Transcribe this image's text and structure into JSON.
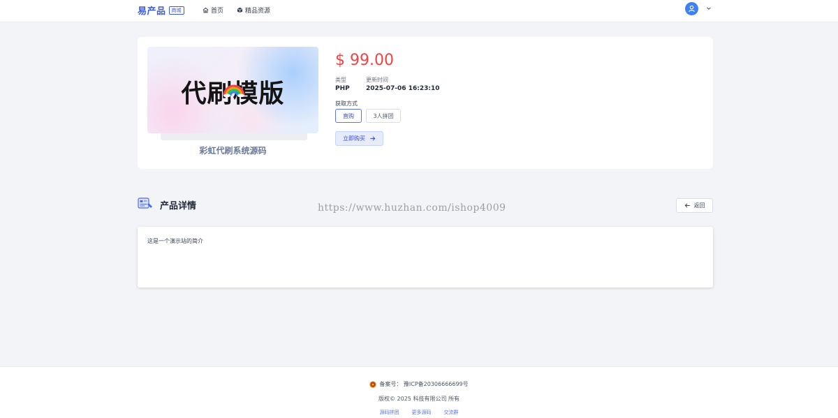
{
  "header": {
    "brand": "易产品",
    "brand_tag": "商城",
    "nav": [
      {
        "label": "首页",
        "icon": "home-icon"
      },
      {
        "label": "精品资源",
        "icon": "cube-icon"
      }
    ],
    "avatar_icon": "user-icon",
    "accent_color": "#3b5bdb"
  },
  "product": {
    "cover_text": "代刷模版",
    "title": "彩虹代刷系统源码",
    "price": "$ 99.00",
    "type_label": "类型",
    "type_value": "PHP",
    "updated_label": "更新时间",
    "updated_value": "2025-07-06 16:23:10",
    "get_label": "获取方式",
    "options": [
      "直购",
      "3人拼团"
    ],
    "selected_option": "直购",
    "buy_label": "立即购买",
    "price_color": "#ef4444"
  },
  "detail": {
    "title": "产品详情",
    "watermark": "https://www.huzhan.com/ishop4009",
    "back_label": "返回",
    "description": "这是一个演示站的简介"
  },
  "footer": {
    "icp": "备案号： 豫ICP备20306666699号",
    "copyright": "版权© 2025 科技有限公司 所有",
    "links": [
      "源码拼团",
      "更多源码",
      "交流群"
    ]
  }
}
